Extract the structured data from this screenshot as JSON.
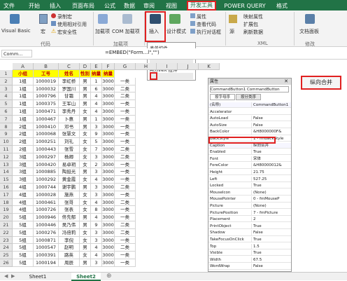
{
  "ribbon": {
    "tabs": [
      "文件",
      "开始",
      "插入",
      "页面布局",
      "公式",
      "数据",
      "审阅",
      "视图",
      "开发工具",
      "POWER QUERY",
      "格式"
    ],
    "code": {
      "vb": "Visual Basic",
      "macro": "宏",
      "record": "录制宏",
      "relative": "使用相对引用",
      "security": "宏安全性",
      "group": "代码"
    },
    "addins": {
      "addin": "加载项",
      "com": "COM 加载项",
      "group": "加载项"
    },
    "controls": {
      "insert": "插入",
      "design": "设计模式",
      "properties": "属性",
      "view_code": "查看代码",
      "run_dialog": "执行对话框"
    },
    "xml": {
      "source": "源",
      "map_props": "映射属性",
      "expansion": "扩展包",
      "refresh": "刷新数据",
      "group": "XML"
    },
    "modify": {
      "doc_panel": "文档面板",
      "group": "修改"
    }
  },
  "dropdown": {
    "form_controls": "表单控件",
    "activex_controls": "ActiveX 控件"
  },
  "formula": {
    "name_box": "Comm...",
    "content": "=EMBED(\"Form...l\",\"\")"
  },
  "columns": [
    "A",
    "B",
    "C",
    "D",
    "E",
    "F",
    "G",
    "H",
    "I",
    "J",
    "K"
  ],
  "table": {
    "headers": [
      "小组",
      "工号",
      "姓名",
      "性别",
      "纳量",
      "纳量"
    ],
    "rows": [
      [
        "1组",
        "1000019",
        "李虹桥",
        "男",
        "1",
        "3000",
        "一类"
      ],
      [
        "1组",
        "1000032",
        "罗国川",
        "男",
        "6",
        "3000",
        "二类"
      ],
      [
        "1组",
        "1000796",
        "甘霜",
        "男",
        "4",
        "3000",
        "二类"
      ],
      [
        "1组",
        "1000375",
        "王军山",
        "男",
        "4",
        "3000",
        "一类"
      ],
      [
        "1组",
        "1000471",
        "李秀丹",
        "女",
        "4",
        "3000",
        "一类"
      ],
      [
        "1组",
        "1000467",
        "卜惠",
        "男",
        "1",
        "3000",
        "一类"
      ],
      [
        "2组",
        "1000410",
        "邓书",
        "男",
        "3",
        "3000",
        "一类"
      ],
      [
        "2组",
        "1000068",
        "张慧文",
        "女",
        "9",
        "3000",
        "一类"
      ],
      [
        "2组",
        "1000251",
        "刘礼",
        "女",
        "5",
        "3000",
        "一类"
      ],
      [
        "2组",
        "1000443",
        "张雪",
        "女",
        "7",
        "3000",
        "二类"
      ],
      [
        "3组",
        "1000297",
        "杨卿",
        "女",
        "3",
        "3000",
        "二类"
      ],
      [
        "3组",
        "1000420",
        "易卓玥",
        "女",
        "2",
        "3000",
        "一类"
      ],
      [
        "3组",
        "1000885",
        "陶挺光",
        "男",
        "3",
        "3000",
        "一类"
      ],
      [
        "3组",
        "1000292",
        "黄金霞",
        "女",
        "4",
        "3000",
        "一类"
      ],
      [
        "4组",
        "1000744",
        "谢宇鹏",
        "男",
        "3",
        "3000",
        "二类"
      ],
      [
        "4组",
        "1000028",
        "施燕",
        "女",
        "3",
        "3000",
        "一类"
      ],
      [
        "4组",
        "1000461",
        "张哥",
        "女",
        "4",
        "3000",
        "二类"
      ],
      [
        "4组",
        "1000726",
        "张表",
        "女",
        "8",
        "3000",
        "一类"
      ],
      [
        "5组",
        "1000946",
        "佟先郁",
        "男",
        "4",
        "3000",
        "一类"
      ],
      [
        "5组",
        "1000446",
        "吴乃伟",
        "男",
        "9",
        "3000",
        "二类"
      ],
      [
        "5组",
        "1000276",
        "冯倍莉",
        "女",
        "3",
        "3000",
        "二类"
      ],
      [
        "5组",
        "1000871",
        "李倪",
        "女",
        "3",
        "3000",
        "一类"
      ],
      [
        "5组",
        "1000547",
        "赵明",
        "男",
        "4",
        "3000",
        "二类"
      ],
      [
        "5组",
        "1000391",
        "路英",
        "女",
        "4",
        "3000",
        "一类"
      ],
      [
        "5组",
        "1000194",
        "周辰",
        "男",
        "3",
        "3000",
        "一类"
      ]
    ]
  },
  "properties": {
    "title": "属性",
    "object": "CommandButton1 CommandButton",
    "tab_alpha": "按字母序",
    "tab_cat": "按分类序",
    "items": [
      [
        "(名称)",
        "CommandButton1"
      ],
      [
        "Accelerator",
        ""
      ],
      [
        "AutoLoad",
        "False"
      ],
      [
        "AutoSize",
        "False"
      ],
      [
        "BackColor",
        "&H8000000F&"
      ],
      [
        "BackStyle",
        "1 - fmBackStyle"
      ],
      [
        "Caption",
        "纵向合并"
      ],
      [
        "Enabled",
        "True"
      ],
      [
        "Font",
        "宋体"
      ],
      [
        "ForeColor",
        "&H80000012&"
      ],
      [
        "Height",
        "21.75"
      ],
      [
        "Left",
        "527.25"
      ],
      [
        "Locked",
        "True"
      ],
      [
        "MouseIcon",
        "(None)"
      ],
      [
        "MousePointer",
        "0 - fmMouseP"
      ],
      [
        "Picture",
        "(None)"
      ],
      [
        "PicturePosition",
        "7 - fmPicture"
      ],
      [
        "Placement",
        "2"
      ],
      [
        "PrintObject",
        "True"
      ],
      [
        "Shadow",
        "False"
      ],
      [
        "TakeFocusOnClick",
        "True"
      ],
      [
        "Top",
        "1.5"
      ],
      [
        "Visible",
        "True"
      ],
      [
        "Width",
        "67.5"
      ],
      [
        "WordWrap",
        "False"
      ]
    ]
  },
  "button": {
    "label": "纵向合并"
  },
  "sheets": [
    "Sheet1",
    "Sheet2"
  ],
  "colors": {
    "ribbon": "#217346",
    "highlight": "#e02020",
    "header_fill": "#ffff00"
  }
}
